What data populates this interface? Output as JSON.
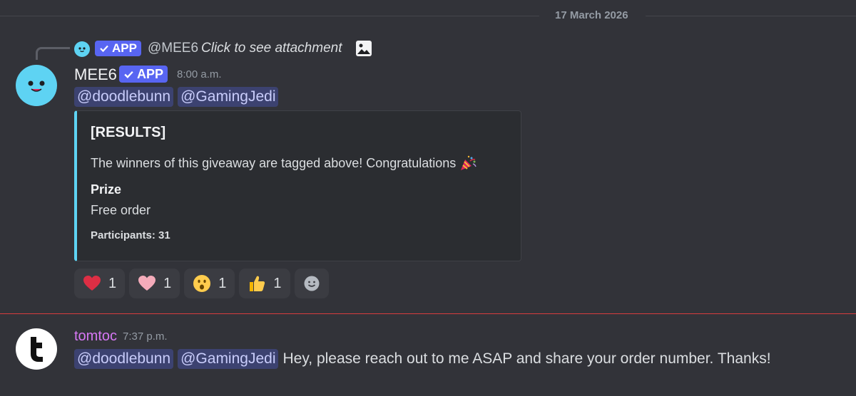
{
  "divider": {
    "date": "17 March 2026"
  },
  "reply": {
    "badge": "APP",
    "author": "@MEE6",
    "text": "Click to see attachment"
  },
  "message1": {
    "author": "MEE6",
    "badge": "APP",
    "timestamp": "8:00 a.m.",
    "mentions": [
      "@doodlebunn",
      "@GamingJedi"
    ],
    "embed": {
      "title": "[RESULTS]",
      "description": "The winners of this giveaway are tagged above! Congratulations",
      "field_name": "Prize",
      "field_value": "Free order",
      "footer": "Participants: 31",
      "accent_color": "#5ed3f3"
    },
    "reactions": [
      {
        "icon": "red-heart-icon",
        "count": "1"
      },
      {
        "icon": "pink-heart-icon",
        "count": "1"
      },
      {
        "icon": "astonished-face-icon",
        "count": "1"
      },
      {
        "icon": "thumbs-up-icon",
        "count": "1"
      }
    ]
  },
  "message2": {
    "author": "tomtoc",
    "timestamp": "7:37 p.m.",
    "mentions": [
      "@doodlebunn",
      "@GamingJedi"
    ],
    "text": "Hey, please reach out to me ASAP and share your order number. Thanks!"
  },
  "colors": {
    "background": "#323339",
    "app_badge": "#5865f2",
    "mention_bg": "#3c4270",
    "new_divider": "#d83c3e",
    "tomtoc_name": "#d778f5"
  }
}
